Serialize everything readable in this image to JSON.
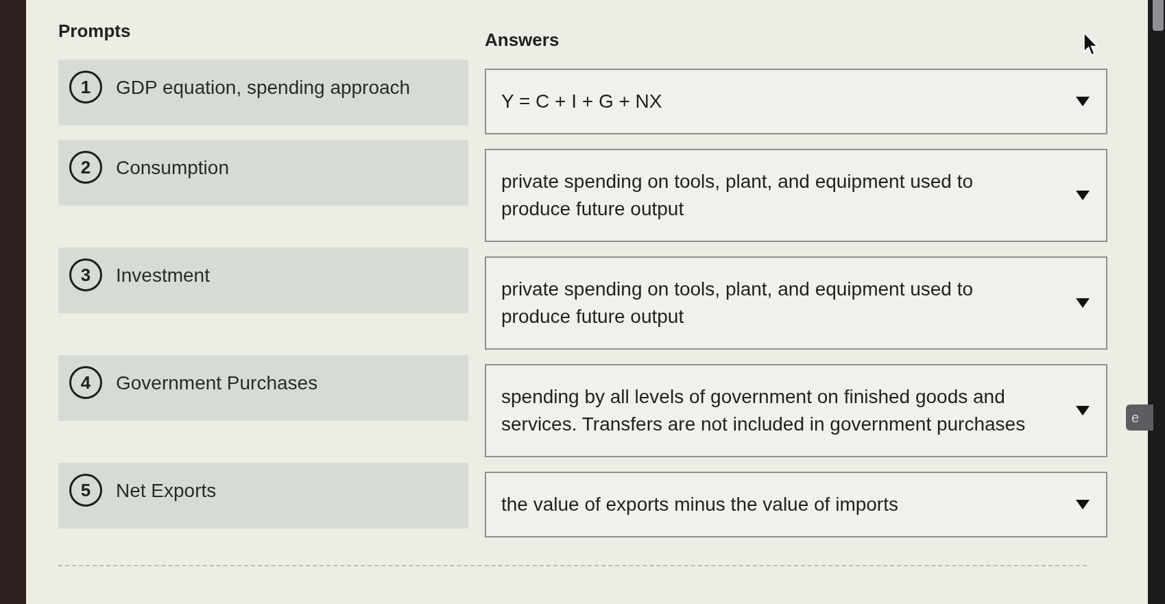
{
  "headings": {
    "prompts": "Prompts",
    "answers": "Answers"
  },
  "rows": [
    {
      "number": "1",
      "prompt": "GDP equation, spending approach",
      "answer": "Y = C + I + G + NX"
    },
    {
      "number": "2",
      "prompt": "Consumption",
      "answer": "private spending on tools, plant, and equipment used to produce future output"
    },
    {
      "number": "3",
      "prompt": "Investment",
      "answer": "private spending on tools, plant, and equipment used to produce future output"
    },
    {
      "number": "4",
      "prompt": "Government Purchases",
      "answer": "spending by all levels of government on finished goods and services. Transfers are not included in government purchases"
    },
    {
      "number": "5",
      "prompt": "Net Exports",
      "answer": "the value of exports minus the value of imports"
    }
  ],
  "side_tab": {
    "label": "e"
  }
}
